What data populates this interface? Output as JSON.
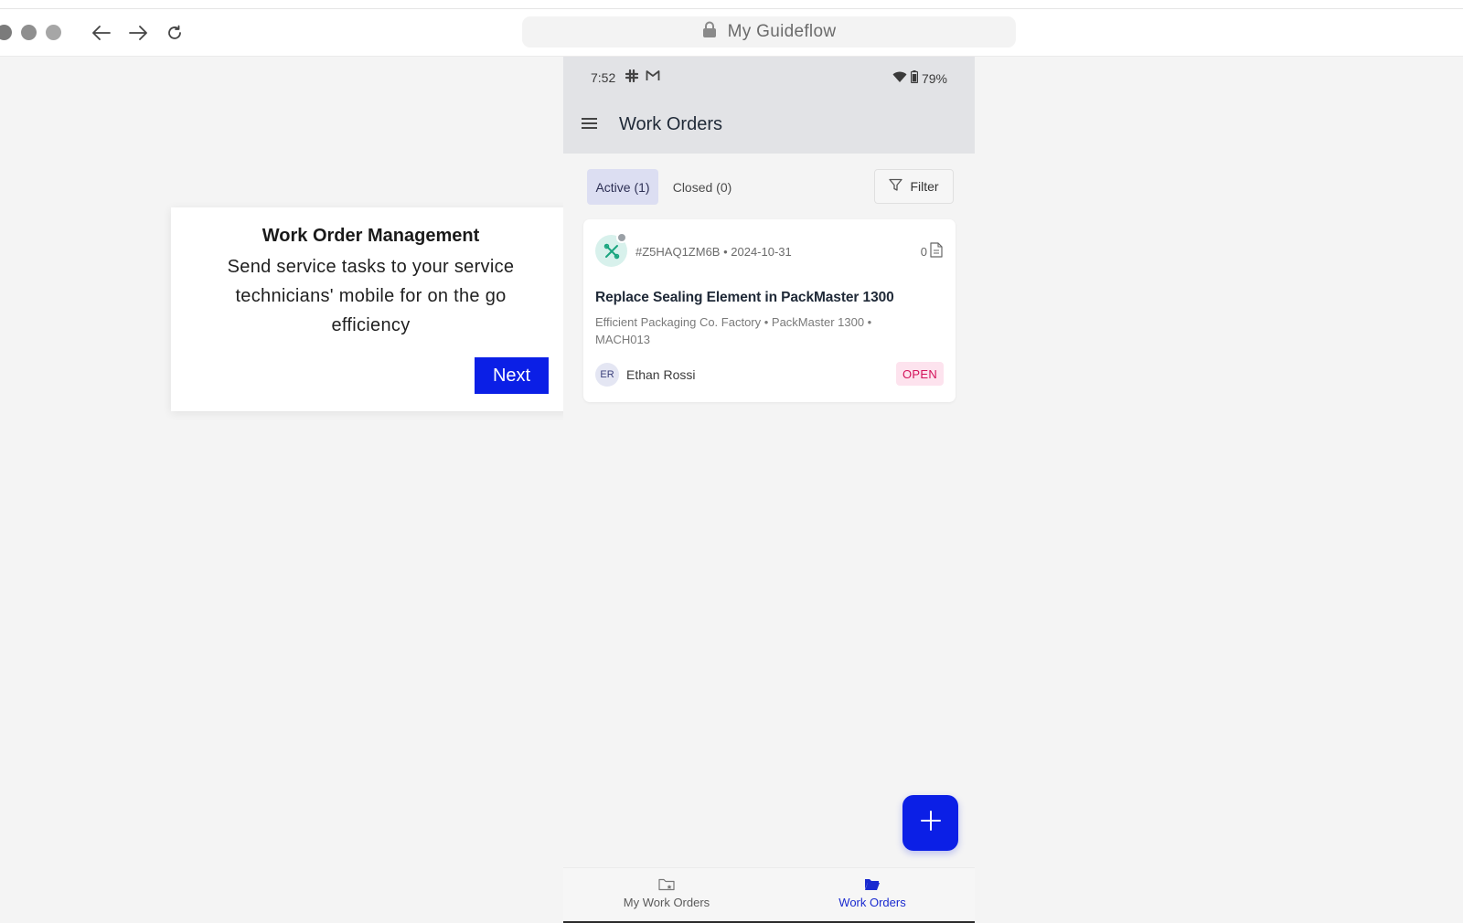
{
  "browser": {
    "url_label": "My Guideflow",
    "icons": [
      "back-arrow-icon",
      "forward-arrow-icon",
      "reload-icon",
      "lock-icon"
    ]
  },
  "tooltip": {
    "title": "Work Order Management",
    "body": "Send service tasks to your service technicians' mobile for on the go efficiency",
    "next_label": "Next"
  },
  "phone": {
    "status": {
      "time": "7:52",
      "battery": "79%"
    },
    "title": "Work Orders",
    "tabs": {
      "active": "Active (1)",
      "closed": "Closed (0)",
      "filter": "Filter"
    },
    "work_order": {
      "id_date": "#Z5HAQ1ZM6B • 2024-10-31",
      "doc_count": "0",
      "title": "Replace Sealing Element in PackMaster 1300",
      "location": "Efficient Packaging Co. Factory • PackMaster 1300 • MACH013",
      "assignee_initials": "ER",
      "assignee_name": "Ethan Rossi",
      "status": "OPEN"
    },
    "bottom_nav": {
      "my_work_orders": "My Work Orders",
      "work_orders": "Work Orders"
    }
  },
  "colors": {
    "accent": "#0b1fe6",
    "status_open_bg": "#fde3ee",
    "status_open_text": "#d3125a",
    "tab_active_bg": "#dcdef2"
  }
}
